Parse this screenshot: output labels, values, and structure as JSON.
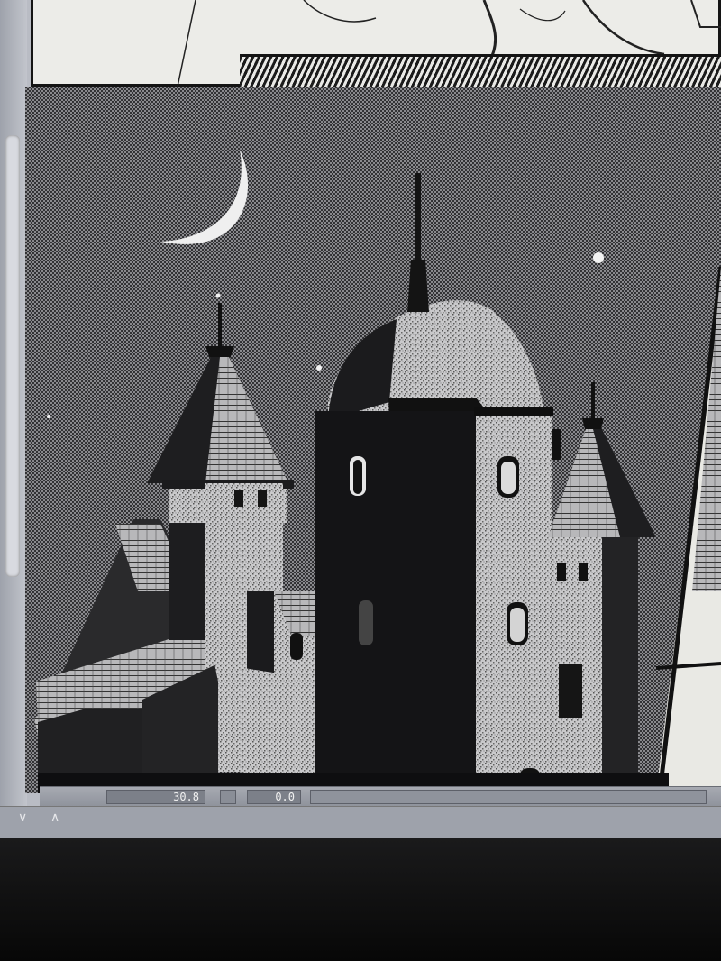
{
  "status_bar": {
    "zoom_value": "30.8",
    "rotation_value": "0.0"
  },
  "icons": {
    "scroll_down": "chevron-down-icon",
    "scroll_up": "chevron-up-icon"
  },
  "colors": {
    "ui_gray": "#b9bcc4",
    "ink": "#1a1a1a",
    "paper": "#ecece8"
  }
}
